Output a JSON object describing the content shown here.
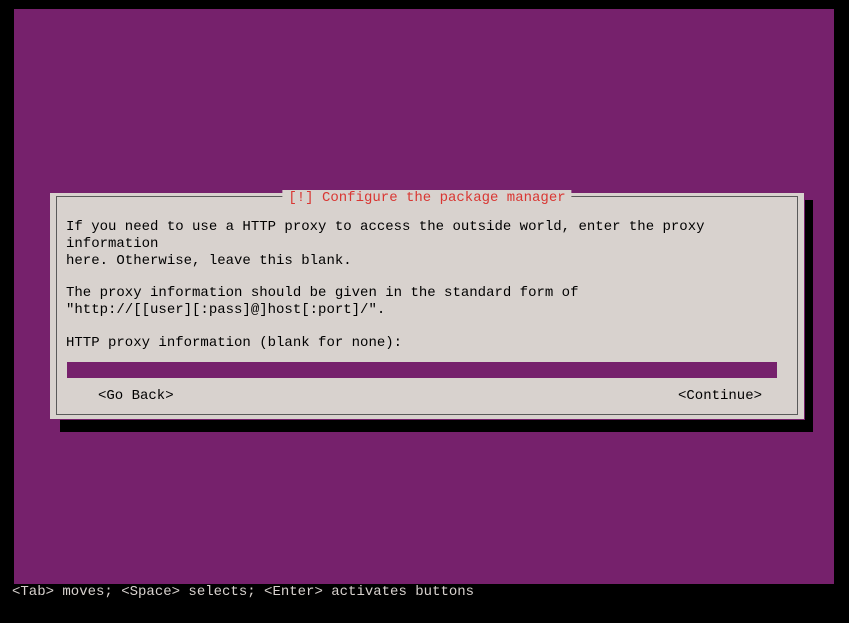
{
  "dialog": {
    "title": "[!] Configure the package manager",
    "para1_line1": "If you need to use a HTTP proxy to access the outside world, enter the proxy information",
    "para1_line2": "here. Otherwise, leave this blank.",
    "para2_line1": "The proxy information should be given in the standard form of",
    "para2_line2": "\"http://[[user][:pass]@]host[:port]/\".",
    "prompt": "HTTP proxy information (blank for none):",
    "input_value": "",
    "back_label": "<Go Back>",
    "continue_label": "<Continue>"
  },
  "help_bar": "<Tab> moves; <Space> selects; <Enter> activates buttons"
}
